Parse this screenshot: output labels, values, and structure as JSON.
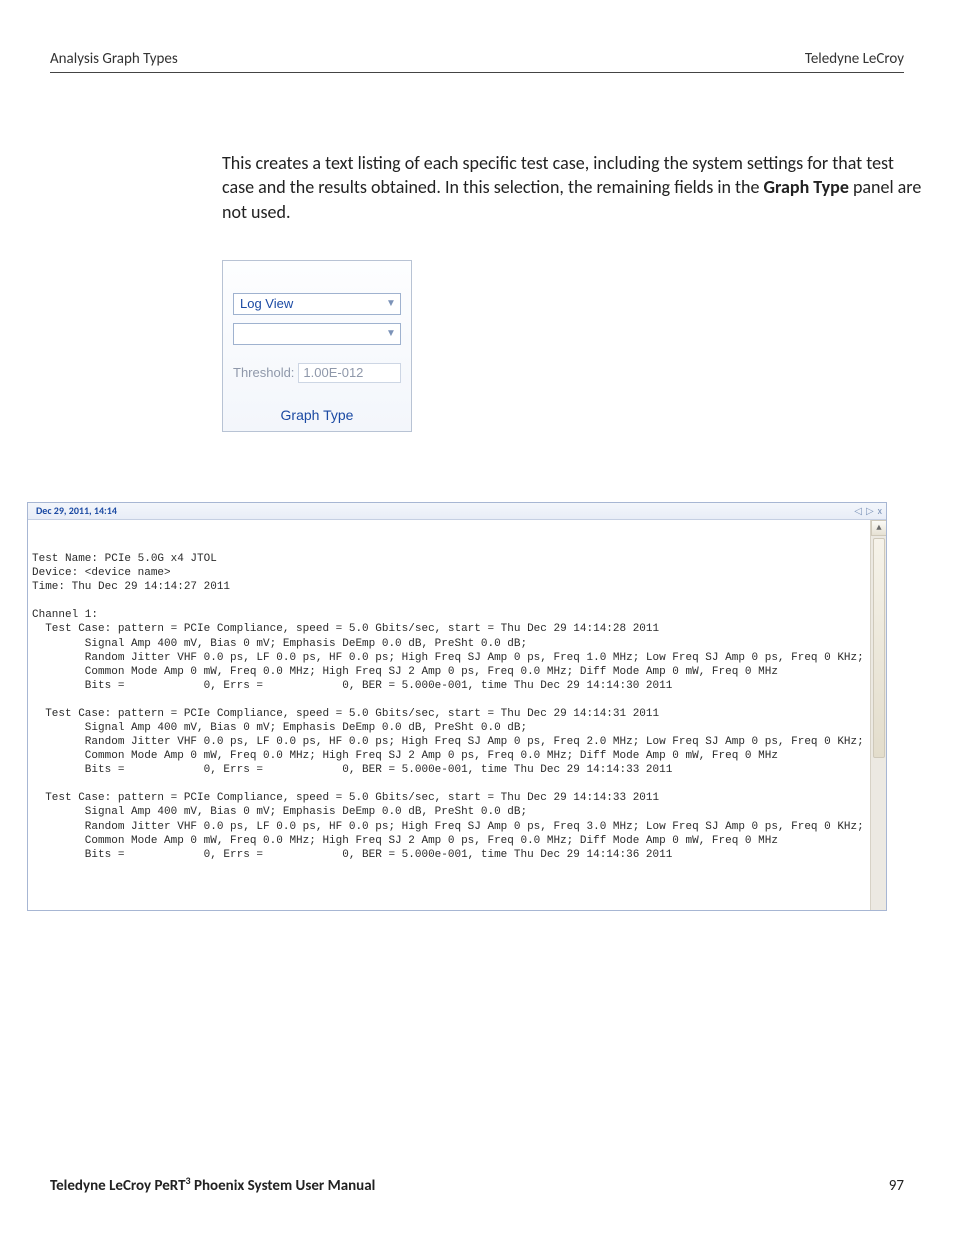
{
  "header": {
    "left": "Analysis Graph Types",
    "right": "Teledyne LeCroy"
  },
  "paragraph": {
    "pre": "This creates a text listing of each specific test case, including the system settings for that test case and the results obtained. In this selection, the remaining fields in the ",
    "bold": "Graph Type",
    "post": " panel are not used."
  },
  "graph_type_panel": {
    "primary_select": "Log View",
    "secondary_select": "",
    "threshold_label": "Threshold:",
    "threshold_value": "1.00E-012",
    "footer": "Graph Type"
  },
  "log_view": {
    "tab": "Dec 29, 2011, 14:14",
    "controls": {
      "prev": "◁",
      "next": "▷",
      "close": "x"
    },
    "scroll_up": "▲",
    "lines": [
      "Test Name: PCIe 5.0G x4 JTOL",
      "Device: <device name>",
      "Time: Thu Dec 29 14:14:27 2011",
      "",
      "Channel 1:",
      "  Test Case: pattern = PCIe Compliance, speed = 5.0 Gbits/sec, start = Thu Dec 29 14:14:28 2011",
      "        Signal Amp 400 mV, Bias 0 mV; Emphasis DeEmp 0.0 dB, PreSht 0.0 dB;",
      "        Random Jitter VHF 0.0 ps, LF 0.0 ps, HF 0.0 ps; High Freq SJ Amp 0 ps, Freq 1.0 MHz; Low Freq SJ Amp 0 ps, Freq 0 KHz;",
      "        Common Mode Amp 0 mW, Freq 0.0 MHz; High Freq SJ 2 Amp 0 ps, Freq 0.0 MHz; Diff Mode Amp 0 mW, Freq 0 MHz",
      "        Bits =            0, Errs =            0, BER = 5.000e-001, time Thu Dec 29 14:14:30 2011",
      "",
      "  Test Case: pattern = PCIe Compliance, speed = 5.0 Gbits/sec, start = Thu Dec 29 14:14:31 2011",
      "        Signal Amp 400 mV, Bias 0 mV; Emphasis DeEmp 0.0 dB, PreSht 0.0 dB;",
      "        Random Jitter VHF 0.0 ps, LF 0.0 ps, HF 0.0 ps; High Freq SJ Amp 0 ps, Freq 2.0 MHz; Low Freq SJ Amp 0 ps, Freq 0 KHz;",
      "        Common Mode Amp 0 mW, Freq 0.0 MHz; High Freq SJ 2 Amp 0 ps, Freq 0.0 MHz; Diff Mode Amp 0 mW, Freq 0 MHz",
      "        Bits =            0, Errs =            0, BER = 5.000e-001, time Thu Dec 29 14:14:33 2011",
      "",
      "  Test Case: pattern = PCIe Compliance, speed = 5.0 Gbits/sec, start = Thu Dec 29 14:14:33 2011",
      "        Signal Amp 400 mV, Bias 0 mV; Emphasis DeEmp 0.0 dB, PreSht 0.0 dB;",
      "        Random Jitter VHF 0.0 ps, LF 0.0 ps, HF 0.0 ps; High Freq SJ Amp 0 ps, Freq 3.0 MHz; Low Freq SJ Amp 0 ps, Freq 0 KHz;",
      "        Common Mode Amp 0 mW, Freq 0.0 MHz; High Freq SJ 2 Amp 0 ps, Freq 0.0 MHz; Diff Mode Amp 0 mW, Freq 0 MHz",
      "        Bits =            0, Errs =            0, BER = 5.000e-001, time Thu Dec 29 14:14:36 2011"
    ]
  },
  "footer": {
    "product_prefix": "Teledyne LeCroy PeRT",
    "product_sup": "3",
    "product_suffix": " Phoenix System User Manual",
    "page": "97"
  }
}
